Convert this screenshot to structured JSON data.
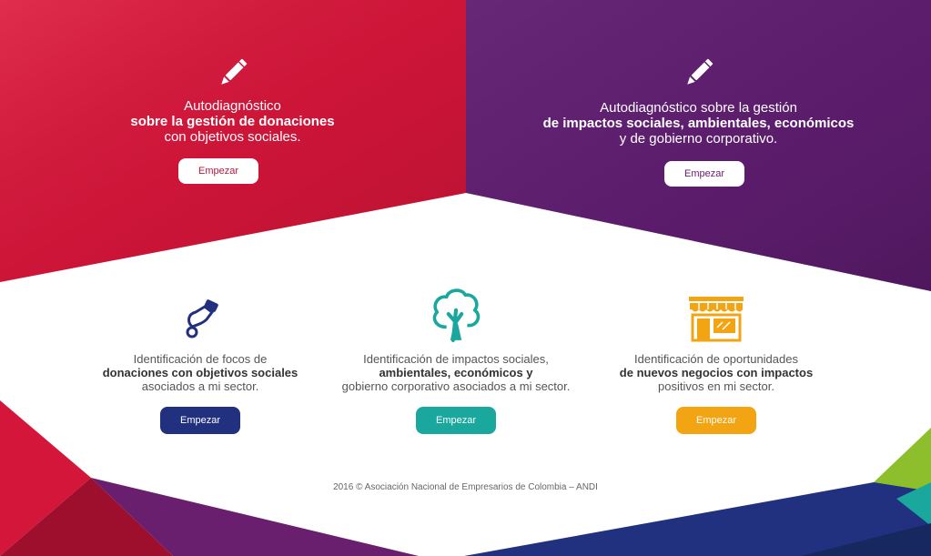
{
  "colors": {
    "red": "#d4163a",
    "purple": "#5e1e6e",
    "navy": "#21317f",
    "teal": "#1aa79e",
    "orange": "#f2a413"
  },
  "hero_left": {
    "icon": "pencil-icon",
    "line1": "Autodiagnóstico",
    "line2": "sobre la gestión de donaciones",
    "line3": "con objetivos sociales.",
    "button": "Empezar"
  },
  "hero_right": {
    "icon": "pencil-icon",
    "line1": "Autodiagnóstico sobre la gestión",
    "line2": "de impactos sociales, ambientales, económicos",
    "line3": "y de gobierno corporativo.",
    "button": "Empezar"
  },
  "features": [
    {
      "icon": "hand-coin-icon",
      "line1": "Identificación de focos de",
      "line2": "donaciones con objetivos sociales",
      "line3": "asociados a mi sector.",
      "button": "Empezar"
    },
    {
      "icon": "tree-icon",
      "line1": "Identificación de impactos sociales,",
      "line2": "ambientales, económicos y",
      "line3": "gobierno corporativo asociados a mi sector.",
      "button": "Empezar"
    },
    {
      "icon": "storefront-icon",
      "line1": "Identificación de oportunidades",
      "line2": "de nuevos negocios con impactos",
      "line3": "positivos en mi sector.",
      "button": "Empezar"
    }
  ],
  "footer": "2016 © Asociación Nacional de Empresarios de Colombia – ANDI"
}
